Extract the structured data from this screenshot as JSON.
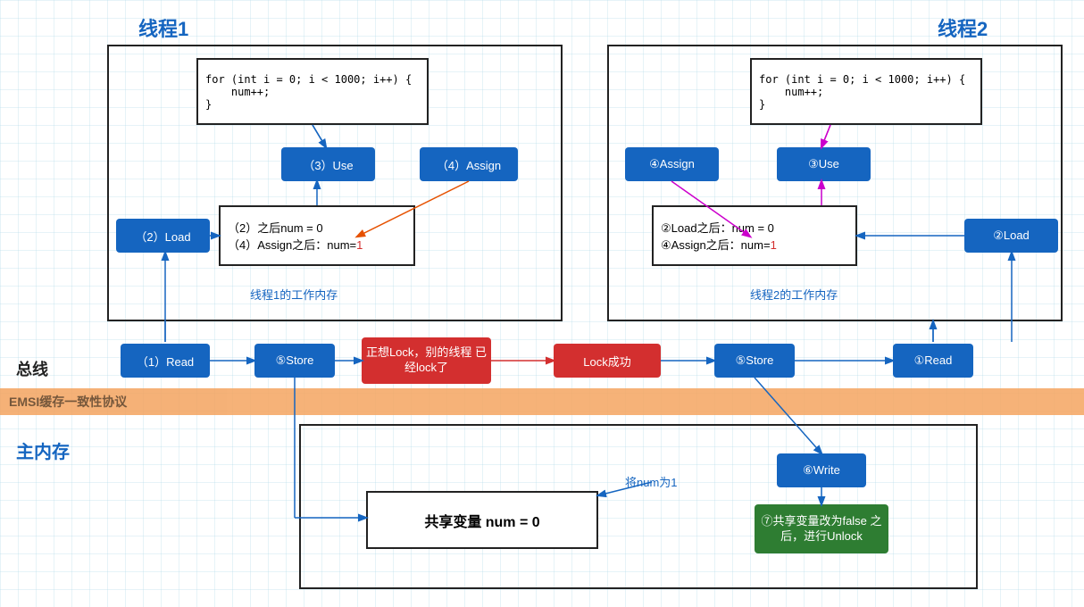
{
  "threads": {
    "thread1_label": "线程1",
    "thread2_label": "线程2"
  },
  "thread1": {
    "code_box": "for (int i = 0; i < 1000; i++) {\n    num++;\n}",
    "load_btn": "（2）Load",
    "use_btn": "（3）Use",
    "assign_btn": "（4）Assign",
    "memory_box_line1": "（2）之后num = 0",
    "memory_box_line2": "（4）Assign之后：num=1",
    "working_mem_label": "线程1的工作内存"
  },
  "thread2": {
    "code_box": "for (int i = 0; i < 1000; i++) {\n    num++;\n}",
    "load_btn": "②Load",
    "use_btn": "③Use",
    "assign_btn": "④Assign",
    "memory_box_line1": "②Load之后：num = 0",
    "memory_box_line2": "④Assign之后：num=1",
    "working_mem_label": "线程2的工作内存"
  },
  "bus": {
    "label": "总线",
    "read1_btn": "（1）Read",
    "store1_btn": "⑤Store",
    "lock_fail_btn": "正想Lock，别的线程\n已经lock了",
    "lock_success_btn": "Lock成功",
    "store2_btn": "⑤Store",
    "read2_btn": "①Read"
  },
  "emsi": {
    "label": "EMSI缓存一致性协议"
  },
  "main_memory": {
    "label": "主内存",
    "shared_var": "共享变量 num = 0",
    "write_btn": "⑥Write",
    "num_label": "将num为1",
    "unlock_btn": "⑦共享变量改为false\n之后，进行Unlock"
  }
}
